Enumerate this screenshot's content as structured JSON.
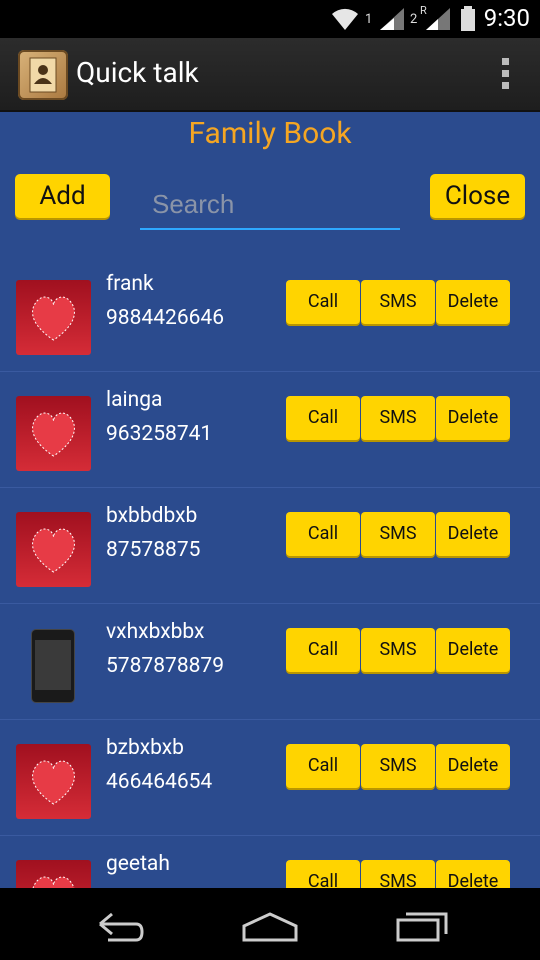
{
  "status_bar": {
    "time": "9:30",
    "sim1_label": "1",
    "sim2_label": "2",
    "roaming_label": "R",
    "icons": [
      "wifi-icon",
      "signal-icon",
      "signal-roaming-icon",
      "battery-icon"
    ]
  },
  "action_bar": {
    "title": "Quick talk",
    "app_icon": "contacts-book-icon",
    "overflow_icon": "overflow-menu-icon"
  },
  "page": {
    "title": "Family Book",
    "add_label": "Add",
    "close_label": "Close",
    "search_placeholder": "Search",
    "search_value": ""
  },
  "contacts": [
    {
      "name": "frank",
      "number": "9884426646",
      "photo": "heart-photo"
    },
    {
      "name": "lainga",
      "number": "963258741",
      "photo": "heart-photo"
    },
    {
      "name": "bxbbdbxb",
      "number": "87578875",
      "photo": "heart-photo"
    },
    {
      "name": "vxhxbxbbx",
      "number": "5787878879",
      "photo": "phone-screenshot-photo"
    },
    {
      "name": "bzbxbxb",
      "number": "466464654",
      "photo": "heart-photo"
    },
    {
      "name": "geetah",
      "number": "",
      "photo": "heart-photo"
    }
  ],
  "row_actions": {
    "call": "Call",
    "sms": "SMS",
    "delete": "Delete"
  },
  "colors": {
    "content_bg": "#2b4b8e",
    "title_orange": "#f5a623",
    "button_yellow": "#ffd400",
    "search_underline": "#2ea8ff"
  },
  "nav_bar": {
    "icons": [
      "back-icon",
      "home-icon",
      "recent-apps-icon"
    ]
  }
}
